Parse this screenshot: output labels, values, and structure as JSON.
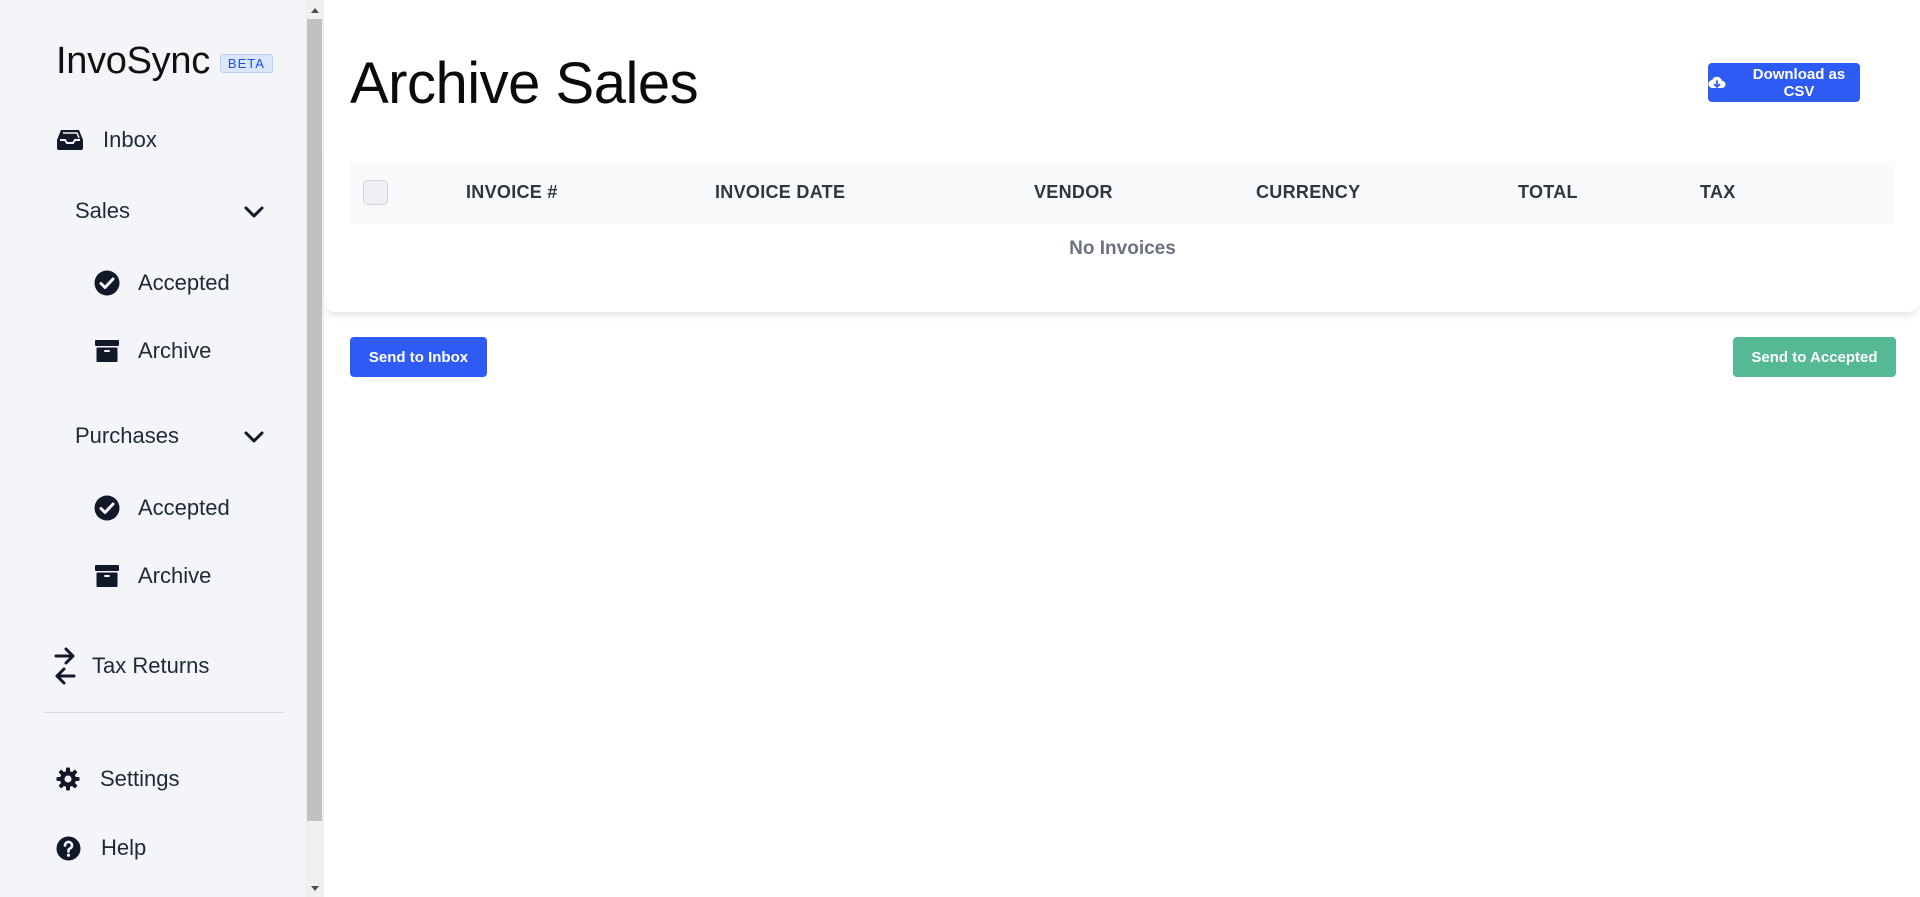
{
  "sidebar": {
    "brand_name": "InvoSync",
    "brand_badge": "BETA",
    "inbox_label": "Inbox",
    "sales": {
      "label": "Sales",
      "accepted_label": "Accepted",
      "archive_label": "Archive"
    },
    "purchases": {
      "label": "Purchases",
      "accepted_label": "Accepted",
      "archive_label": "Archive"
    },
    "tax_returns_label": "Tax Returns",
    "settings_label": "Settings",
    "help_label": "Help"
  },
  "main": {
    "title": "Archive Sales",
    "download_csv_label": "Download as CSV",
    "table": {
      "columns": [
        "INVOICE #",
        "INVOICE DATE",
        "VENDOR",
        "CURRENCY",
        "TOTAL",
        "TAX"
      ],
      "empty_message": "No Invoices"
    },
    "send_to_inbox_label": "Send to Inbox",
    "send_to_accepted_label": "Send to Accepted"
  },
  "colors": {
    "primary": "#2f5bf5",
    "success": "#55b993",
    "sidebar_bg": "#f3f5f8"
  }
}
